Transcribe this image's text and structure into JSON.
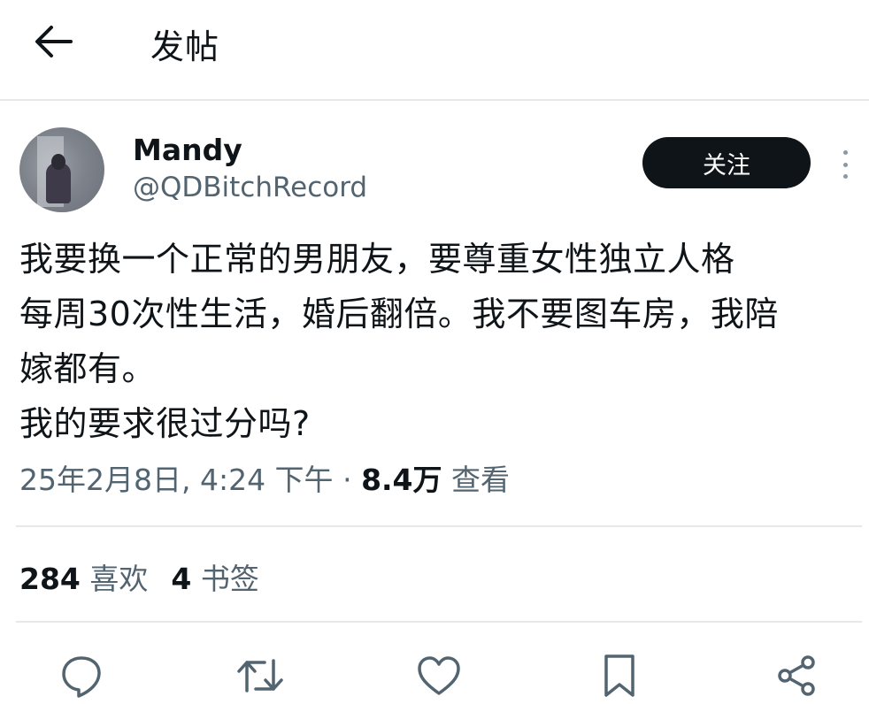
{
  "header": {
    "back_icon": "arrow-left-icon",
    "title": "发帖"
  },
  "author": {
    "display_name": "Mandy",
    "handle": "@QDBitchRecord",
    "avatar_icon": "avatar-photo"
  },
  "follow_label": "关注",
  "more_icon": "more-vertical-icon",
  "post": {
    "lines": [
      "我要换一个正常的男朋友，要尊重女性独立人格",
      "每周30次性生活，婚后翻倍。我不要图车房，我陪",
      "嫁都有。",
      "我的要求很过分吗?"
    ]
  },
  "meta": {
    "timestamp": "25年2月8日, 4:24 下午",
    "separator": "·",
    "views_count": "8.4万",
    "views_label": "查看"
  },
  "stats": {
    "likes_count": "284",
    "likes_label": "喜欢",
    "bookmarks_count": "4",
    "bookmarks_label": "书签"
  },
  "actions": [
    {
      "icon": "reply-icon"
    },
    {
      "icon": "repost-icon"
    },
    {
      "icon": "like-icon"
    },
    {
      "icon": "bookmark-icon"
    },
    {
      "icon": "share-icon"
    }
  ],
  "colors": {
    "text_primary": "#0f1419",
    "text_secondary": "#536471",
    "divider": "#e6e8ea",
    "follow_button_bg": "#0f1419"
  }
}
